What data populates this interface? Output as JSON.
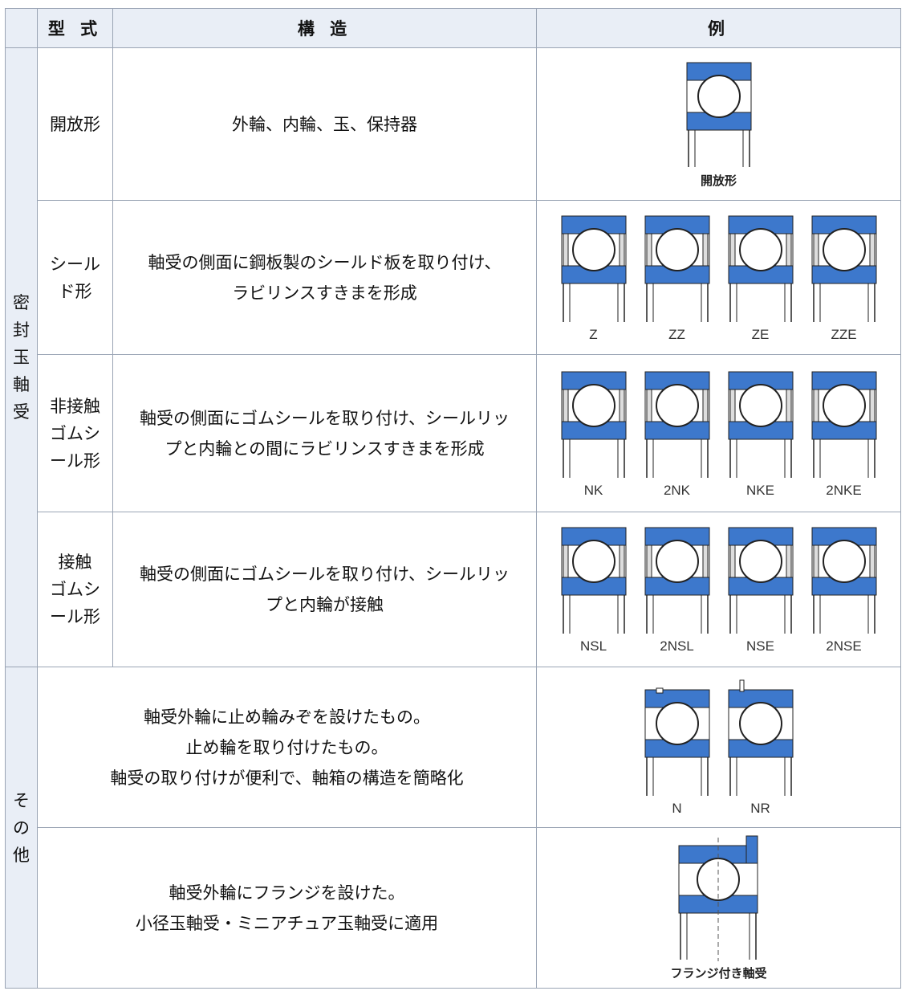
{
  "header": {
    "col_type": "型 式",
    "col_structure": "構 造",
    "col_example": "例"
  },
  "groups": {
    "sealed": [
      "密",
      "封",
      "玉",
      "軸",
      "受"
    ],
    "other": [
      "そ",
      "の",
      "他"
    ]
  },
  "rows": [
    {
      "type_lines": [
        "開放形"
      ],
      "desc_lines": [
        "外輪、内輪、玉、保持器"
      ],
      "figure_labels": [],
      "caption": "開放形"
    },
    {
      "type_lines": [
        "シール",
        "ド形"
      ],
      "desc_lines": [
        "軸受の側面に鋼板製のシールド板を取り付け、",
        "ラビリンスすきまを形成"
      ],
      "figure_labels": [
        "Z",
        "ZZ",
        "ZE",
        "ZZE"
      ]
    },
    {
      "type_lines": [
        "非接触",
        "ゴムシ",
        "ール形"
      ],
      "desc_lines": [
        "軸受の側面にゴムシールを取り付け、シールリッ",
        "プと内輪との間にラビリンスすきまを形成"
      ],
      "figure_labels": [
        "NK",
        "2NK",
        "NKE",
        "2NKE"
      ]
    },
    {
      "type_lines": [
        "接触",
        "ゴムシ",
        "ール形"
      ],
      "desc_lines": [
        "軸受の側面にゴムシールを取り付け、シールリッ",
        "プと内輪が接触"
      ],
      "figure_labels": [
        "NSL",
        "2NSL",
        "NSE",
        "2NSE"
      ]
    },
    {
      "desc_lines": [
        "軸受外輪に止め輪みぞを設けたもの。",
        "止め輪を取り付けたもの。",
        "軸受の取り付けが便利で、軸箱の構造を簡略化"
      ],
      "figure_labels": [
        "N",
        "NR"
      ]
    },
    {
      "desc_lines": [
        "軸受外輪にフランジを設けた。",
        "小径玉軸受・ミニアチュア玉軸受に適用"
      ],
      "figure_labels": [],
      "caption": "フランジ付き軸受"
    }
  ],
  "colors": {
    "ring_blue": "#3d78cc",
    "header_bg": "#e9eef6",
    "border": "#9aa4b4"
  }
}
